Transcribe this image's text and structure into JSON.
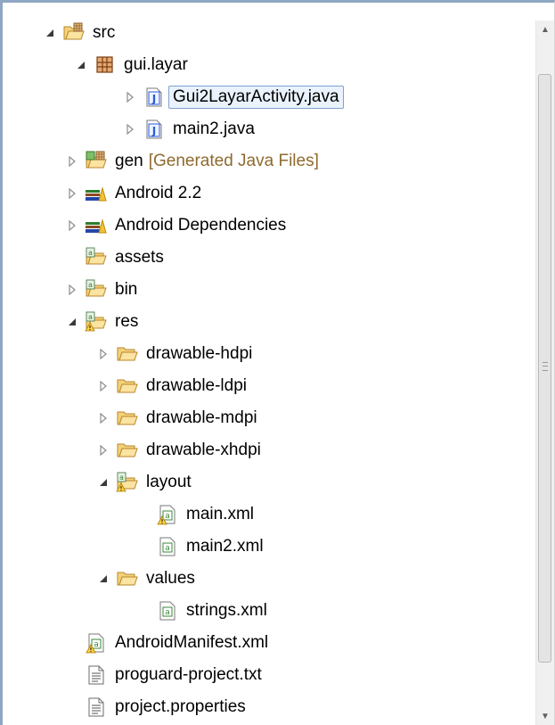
{
  "tree": {
    "src": "src",
    "package": "gui.layar",
    "gui2": "Gui2LayarActivity.java",
    "main2java": "main2.java",
    "gen": "gen",
    "gen_decor": "[Generated Java Files]",
    "android22": "Android 2.2",
    "android_deps": "Android Dependencies",
    "assets": "assets",
    "bin": "bin",
    "res": "res",
    "drawable_hdpi": "drawable-hdpi",
    "drawable_ldpi": "drawable-ldpi",
    "drawable_mdpi": "drawable-mdpi",
    "drawable_xhdpi": "drawable-xhdpi",
    "layout": "layout",
    "main_xml": "main.xml",
    "main2_xml": "main2.xml",
    "values": "values",
    "strings_xml": "strings.xml",
    "manifest": "AndroidManifest.xml",
    "proguard": "proguard-project.txt",
    "project_props": "project.properties"
  },
  "icons": {
    "expanded": "triangle-down-icon",
    "collapsed": "triangle-right-icon",
    "folder": "folder-icon",
    "package": "package-icon",
    "java": "java-file-icon",
    "library": "library-icon",
    "xml": "xml-file-icon",
    "text": "text-file-icon"
  },
  "colors": {
    "frame_border": "#8fa7c4",
    "selection_bg": "#eaf3fd",
    "selection_border": "#7da2ce",
    "decoration": "#8e6a2e"
  }
}
